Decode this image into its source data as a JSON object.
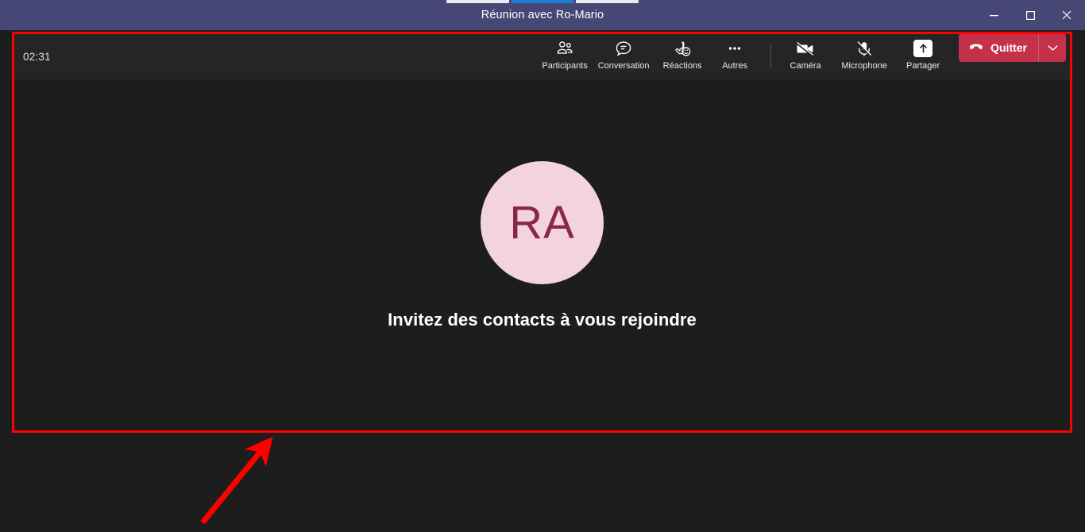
{
  "window": {
    "title": "Réunion avec Ro-Mario",
    "titlebar_color": "#464775",
    "controls": {
      "minimize": "minimize-button",
      "maximize": "maximize-button",
      "close": "close-button"
    }
  },
  "top_strip": {
    "segments": [
      "inactive",
      "active",
      "inactive"
    ],
    "active_color": "#1a7fd4",
    "inactive_color": "#e9e9ef"
  },
  "toolbar": {
    "timer": "02:31",
    "items": [
      {
        "label": "Participants",
        "icon": "people-icon",
        "state": "normal"
      },
      {
        "label": "Conversation",
        "icon": "chat-icon",
        "state": "normal"
      },
      {
        "label": "Réactions",
        "icon": "reactions-icon",
        "state": "normal"
      },
      {
        "label": "Autres",
        "icon": "more-ellipsis-icon",
        "state": "normal"
      },
      {
        "label": "Caméra",
        "icon": "camera-off-icon",
        "state": "off"
      },
      {
        "label": "Microphone",
        "icon": "microphone-off-icon",
        "state": "off"
      },
      {
        "label": "Partager",
        "icon": "share-screen-icon",
        "state": "active"
      }
    ],
    "leave": {
      "label": "Quitter",
      "icon": "hangup-icon",
      "caret_icon": "chevron-down-icon",
      "color": "#c4314b"
    }
  },
  "stage": {
    "avatar": {
      "initials": "RA",
      "background": "#f4d3e0",
      "text_color": "#8b2845"
    },
    "caption": "Invitez des contacts à vous rejoindre"
  },
  "annotation": {
    "box_color": "#ff0000",
    "arrow_color": "#ff0000"
  }
}
